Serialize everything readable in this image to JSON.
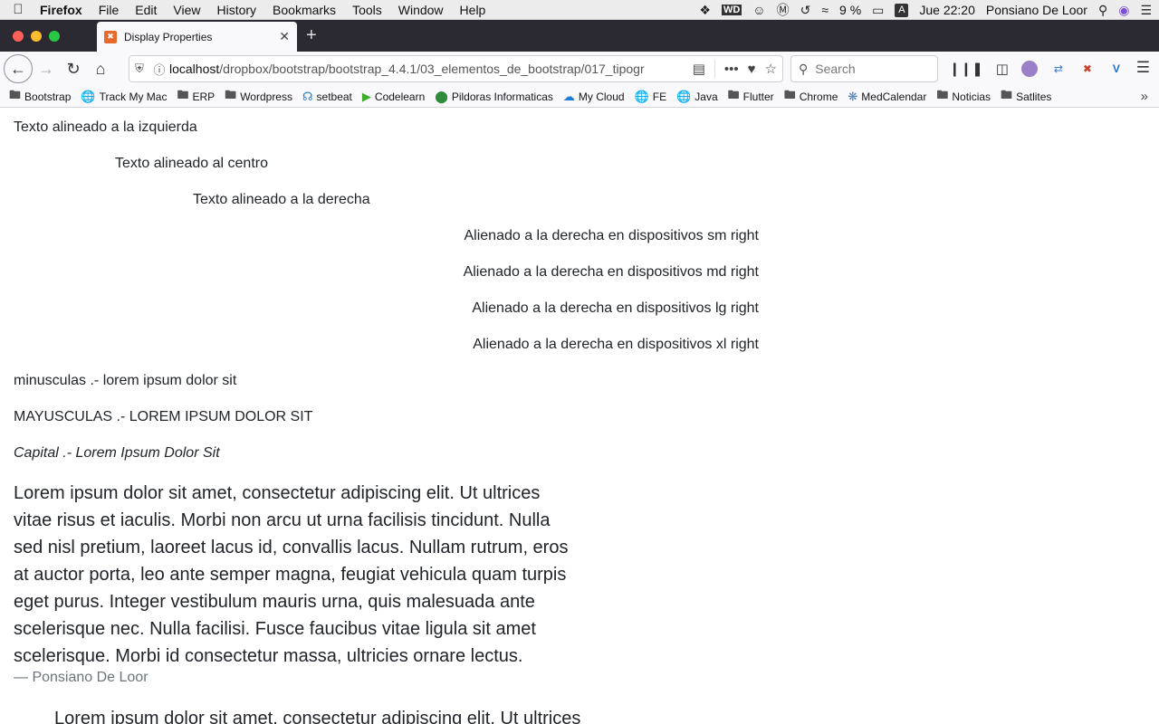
{
  "menubar": {
    "app": "Firefox",
    "items": [
      "File",
      "Edit",
      "View",
      "History",
      "Bookmarks",
      "Tools",
      "Window",
      "Help"
    ],
    "battery": "9 %",
    "input_source": "A",
    "clock": "Jue 22:20",
    "user": "Ponsiano De Loor"
  },
  "tab": {
    "title": "Display Properties"
  },
  "urlbar": {
    "host": "localhost",
    "path": "/dropbox/bootstrap/bootstrap_4.4.1/03_elementos_de_bootstrap/017_tipogr"
  },
  "search": {
    "placeholder": "Search"
  },
  "bookmarks": [
    {
      "label": "Bootstrap",
      "icon": "folder-icon"
    },
    {
      "label": "Track My Mac",
      "icon": "globe-icon"
    },
    {
      "label": "ERP",
      "icon": "folder-icon"
    },
    {
      "label": "Wordpress",
      "icon": "folder-icon"
    },
    {
      "label": "setbeat",
      "icon": "headphones-icon"
    },
    {
      "label": "Codelearn",
      "icon": "codelearn-icon"
    },
    {
      "label": "Pildoras Informaticas",
      "icon": "pildoras-icon"
    },
    {
      "label": "My Cloud",
      "icon": "cloud-icon"
    },
    {
      "label": "FE",
      "icon": "globe-icon"
    },
    {
      "label": "Java",
      "icon": "globe-icon"
    },
    {
      "label": "Flutter",
      "icon": "folder-icon"
    },
    {
      "label": "Chrome",
      "icon": "folder-icon"
    },
    {
      "label": "MedCalendar",
      "icon": "medcalendar-icon"
    },
    {
      "label": "Noticias",
      "icon": "folder-icon"
    },
    {
      "label": "Satlites",
      "icon": "folder-icon"
    }
  ],
  "content": {
    "left": "Texto alineado a la izquierda",
    "center": "Texto alineado al centro",
    "right": "Texto alineado a la derecha",
    "sm_right": "Alienado a la derecha en dispositivos sm right",
    "md_right": "Alienado a la derecha en dispositivos md right",
    "lg_right": "Alienado a la derecha en dispositivos lg right",
    "xl_right": "Alienado a la derecha en dispositivos xl right",
    "lowercase": "minusculas .- lorem ipsum dolor sit",
    "uppercase": "MAYUSCULAS .- LOREM IPSUM DOLOR SIT",
    "capitalize": "Capital .- Lorem Ipsum Dolor Sit",
    "lead": "Lorem ipsum dolor sit amet, consectetur adipiscing elit. Ut ultrices vitae risus et iaculis. Morbi non arcu ut urna facilisis tincidunt. Nulla sed nisl pretium, laoreet lacus id, convallis lacus. Nullam rutrum, eros at auctor porta, leo ante semper magna, feugiat vehicula quam turpis eget purus. Integer vestibulum mauris urna, quis malesuada ante scelerisque nec. Nulla facilisi. Fusce faucibus vitae ligula sit amet scelerisque. Morbi id consectetur massa, ultricies ornare lectus.",
    "author": "— Ponsiano De Loor",
    "lead2": "Lorem ipsum dolor sit amet, consectetur adipiscing elit. Ut ultrices"
  }
}
